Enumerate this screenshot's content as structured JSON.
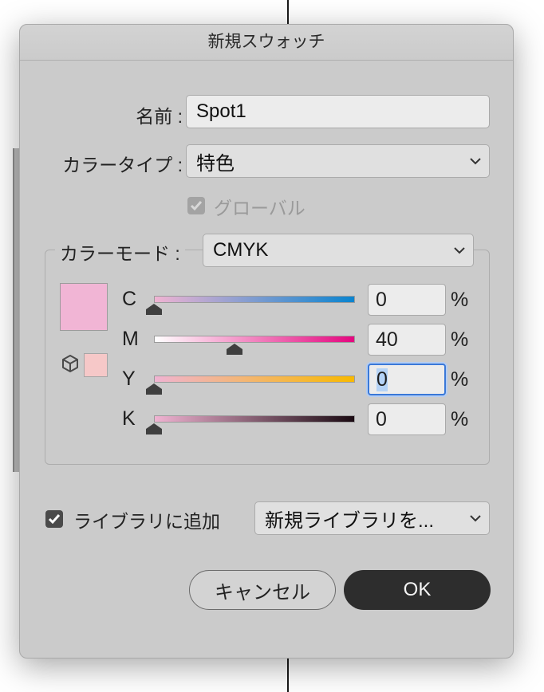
{
  "dialog": {
    "title": "新規スウォッチ",
    "name_label": "名前 :",
    "name_value": "Spot1",
    "color_type_label": "カラータイプ :",
    "color_type_value": "特色",
    "global_label": "グローバル",
    "global_checked": true,
    "global_enabled": false,
    "color_mode_label": "カラーモード :",
    "color_mode_value": "CMYK",
    "swatch_color": "#f1b5d5",
    "gamut_swatch_color": "#f6c8c8",
    "gamut_icon": "cube-icon",
    "channels": [
      {
        "label": "C",
        "value": "0",
        "unit": "%",
        "level": 0
      },
      {
        "label": "M",
        "value": "40",
        "unit": "%",
        "level": 40
      },
      {
        "label": "Y",
        "value": "0",
        "unit": "%",
        "level": 0
      },
      {
        "label": "K",
        "value": "0",
        "unit": "%",
        "level": 0
      }
    ],
    "add_to_library_label": "ライブラリに追加",
    "add_to_library_checked": true,
    "library_select_value": "新規ライブラリを...",
    "cancel_label": "キャンセル",
    "ok_label": "OK"
  }
}
